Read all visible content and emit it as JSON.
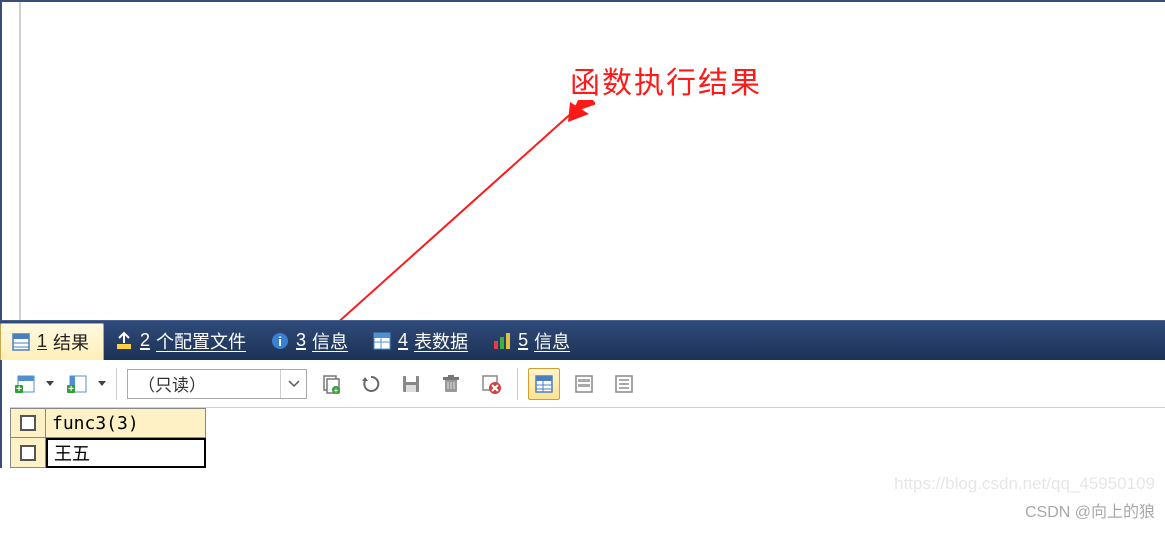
{
  "annotation": {
    "text": "函数执行结果"
  },
  "tabs": [
    {
      "num": "1",
      "label": "结果",
      "active": true
    },
    {
      "num": "2",
      "label": "个配置文件",
      "active": false
    },
    {
      "num": "3",
      "label": "信息",
      "active": false
    },
    {
      "num": "4",
      "label": "表数据",
      "active": false
    },
    {
      "num": "5",
      "label": "信息",
      "active": false
    }
  ],
  "toolbar": {
    "readonly_label": "（只读）"
  },
  "grid": {
    "header": "func3(3)",
    "value": "王五"
  },
  "watermark1": "https://blog.csdn.net/qq_45950109",
  "watermark2": "CSDN @向上的狼"
}
